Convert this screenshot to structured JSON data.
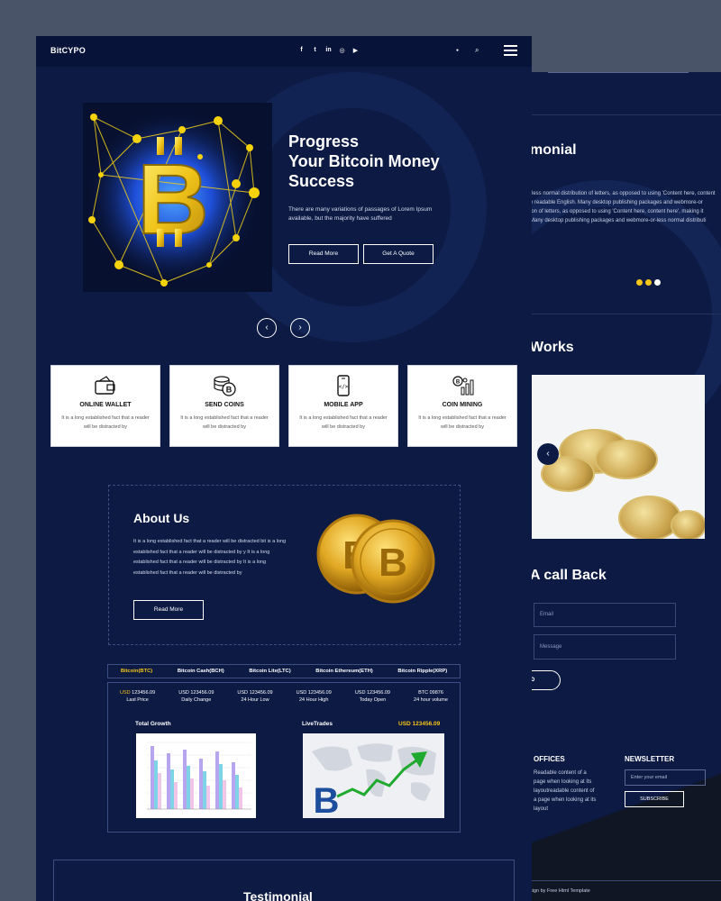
{
  "back_page": {
    "testimonial_heading": "monial",
    "testimonial_lines": [
      "-less normal distribution of letters, as opposed to using 'Content here, content",
      "e readable English. Many desktop publishing packages and webmore-or",
      "ion of letters, as opposed to using 'Content here, content here', making it",
      "Many desktop publishing packages and webmore-or-less normal distributi"
    ],
    "works_heading": "Works",
    "callback_heading": "A call Back",
    "email_placeholder": "Email",
    "message_placeholder": "Message",
    "send_label": "D",
    "offices_heading": "OFFICES",
    "offices_text": "Readable content of a page when looking at its layoutreadable content of a page when looking at its layout",
    "newsletter_heading": "NEWSLETTER",
    "newsletter_placeholder": "Enter your email",
    "subscribe_label": "SUBSCRIBE",
    "copyright": "sign by Free Html Template"
  },
  "navbar": {
    "brand": "BitCYPO",
    "social_icons": [
      "facebook-icon",
      "twitter-icon",
      "linkedin-icon",
      "instagram-icon",
      "youtube-icon"
    ],
    "social_glyphs": [
      "f",
      "t",
      "in",
      "◎",
      "▶"
    ],
    "user_glyph": "●",
    "search_glyph": "⌕"
  },
  "hero": {
    "title_lines": [
      "Progress",
      "Your Bitcoin Money",
      "Success"
    ],
    "subtitle": "There are many variations of passages of Lorem Ipsum available, but the majority have suffered",
    "read_more": "Read More",
    "get_quote": "Get A Quote",
    "prev_glyph": "‹",
    "next_glyph": "›"
  },
  "features": [
    {
      "title": "ONLINE WALLET",
      "text": "It is a long established fact that a reader will be distracted by",
      "icon": "wallet-icon"
    },
    {
      "title": "SEND COINS",
      "text": "It is a long established fact that a reader will be distracted by",
      "icon": "coins-icon"
    },
    {
      "title": "MOBILE APP",
      "text": "It is a long established fact that a reader will be distracted by",
      "icon": "mobile-icon"
    },
    {
      "title": "COIN MINING",
      "text": "It is a long established fact that a reader will be distracted by",
      "icon": "mining-icon"
    }
  ],
  "about": {
    "title": "About Us",
    "text": "It is a long established fact that a reader will be distracted bit is a long established fact that a reader will be distracted by y It is a long established fact that a reader will be distracted by It is a long established fact that a reader will be distracted by",
    "read_more": "Read More"
  },
  "ticker": {
    "tabs": [
      "Bitcoin(BTC)",
      "Bitcoin Cash(BCH)",
      "Bitcoin Lite(LTC)",
      "Bitcoin Ethereum(ETH)",
      "Bitcoin Ripple(XRP)"
    ],
    "active_tab": 0,
    "stats": [
      {
        "currency": "USD",
        "value": "123456.09",
        "label": "Last Price"
      },
      {
        "currency": "USD",
        "value": "123456.09",
        "label": "Daily Change"
      },
      {
        "currency": "USD",
        "value": "123456.09",
        "label": "24 Hour Low"
      },
      {
        "currency": "USD",
        "value": "123456.09",
        "label": "24 Hour High"
      },
      {
        "currency": "USD",
        "value": "123456.09",
        "label": "Today Open"
      },
      {
        "currency": "BTC",
        "value": "09876",
        "label": "24 hour volume"
      }
    ],
    "total_growth": "Total Growth",
    "live_trades": "LiveTrades",
    "live_price": "USD 123456.09"
  },
  "testimonial": {
    "title": "Testimonial"
  },
  "colors": {
    "accent": "#f5c518",
    "background": "#0c1a44",
    "navbar": "#08133a"
  }
}
